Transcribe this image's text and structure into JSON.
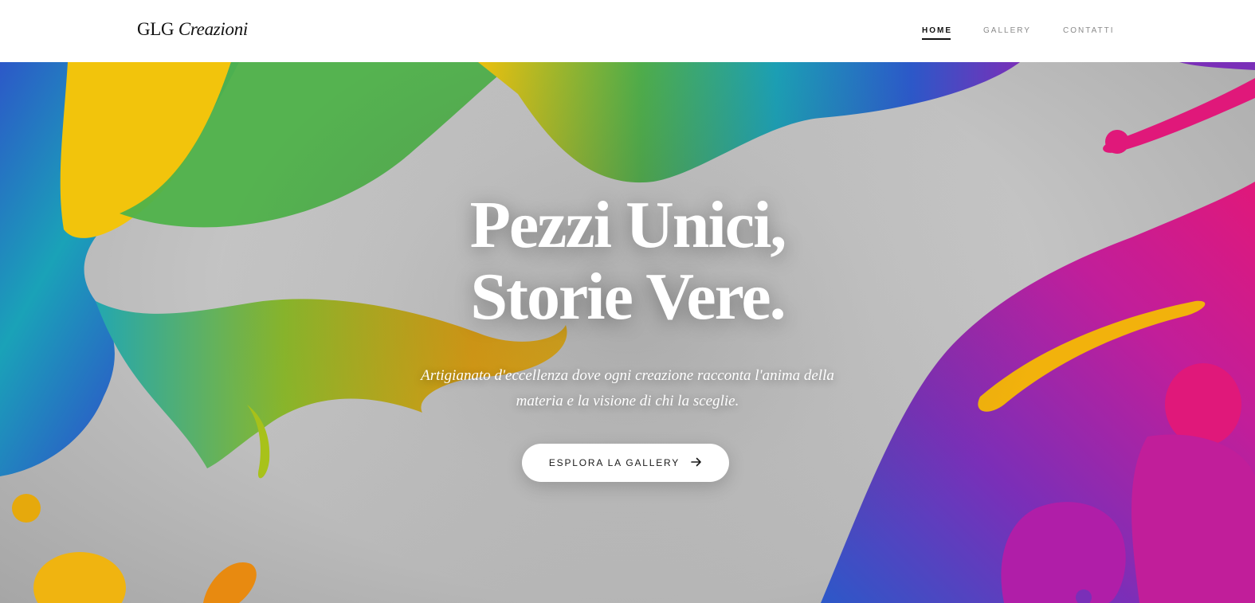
{
  "header": {
    "logo_main": "GLG",
    "logo_italic": "Creazioni",
    "nav": [
      {
        "label": "HOME",
        "active": true
      },
      {
        "label": "GALLERY",
        "active": false
      },
      {
        "label": "CONTATTI",
        "active": false
      }
    ]
  },
  "hero": {
    "title_line1": "Pezzi Unici,",
    "title_line2": "Storie Vere.",
    "subtitle_line1": "Artigianato d'eccellenza dove ogni creazione racconta l'anima della",
    "subtitle_line2": "materia e la visione di chi la sceglie.",
    "cta_label": "ESPLORA LA GALLERY",
    "cta_icon": "arrow-right-icon",
    "background_image": "colorful-paint-splash-illustration"
  },
  "colors": {
    "header_bg": "#ffffff",
    "text_dark": "#111111",
    "nav_inactive": "#8a8a8a",
    "hero_text": "#ffffff",
    "splash_yellow": "#f2c40c",
    "splash_green": "#4fb24a",
    "splash_teal": "#1aa2b8",
    "splash_blue": "#2c58c8",
    "splash_purple": "#7a2fb8",
    "splash_magenta": "#e0187a"
  }
}
